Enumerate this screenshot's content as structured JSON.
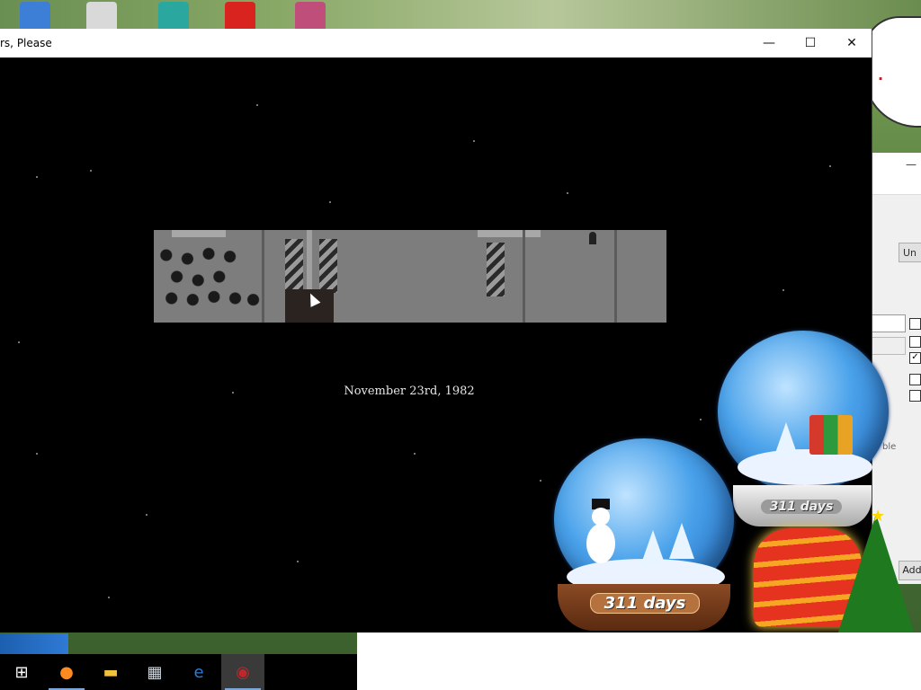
{
  "window": {
    "title": "rs, Please",
    "minimize_icon": "—",
    "maximize_icon": "☐",
    "close_icon": "✕"
  },
  "game": {
    "date_text": "November 23rd, 1982"
  },
  "snow_globes": [
    {
      "label": "311 days"
    },
    {
      "label": "311 days"
    }
  ],
  "background_window": {
    "button_label": "Un",
    "able_text": "ble",
    "add_label": "Add",
    "checkbox_checked_mark": "✓"
  },
  "taskbar": {
    "items": [
      {
        "name": "start",
        "glyph": "⊞"
      },
      {
        "name": "firefox",
        "glyph": "●"
      },
      {
        "name": "file-explorer",
        "glyph": "▬"
      },
      {
        "name": "photos",
        "glyph": "▦"
      },
      {
        "name": "edge",
        "glyph": "e"
      },
      {
        "name": "papers-please",
        "glyph": "◉"
      }
    ]
  }
}
